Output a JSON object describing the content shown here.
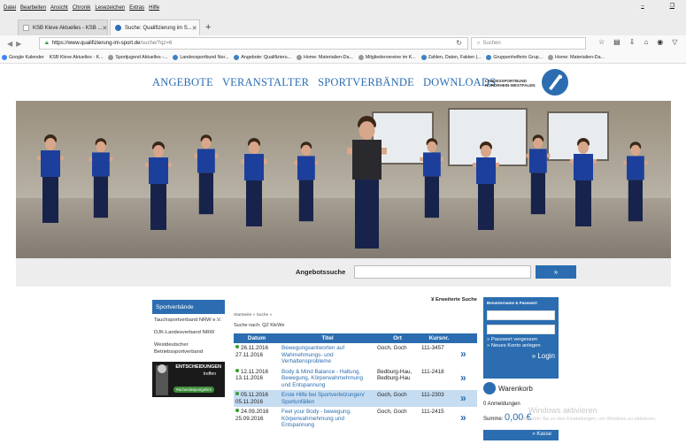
{
  "browser": {
    "menu": [
      "Datei",
      "Bearbeiten",
      "Ansicht",
      "Chronik",
      "Lesezeichen",
      "Extras",
      "Hilfe"
    ],
    "tabs": [
      {
        "label": "KSB Kleve Aktuelles - KSB ..."
      },
      {
        "label": "Suche: Qualifizierung im S..."
      }
    ],
    "url_host": "https://www.qualifizierung-im-sport.de",
    "url_path": "/suche/?qz=6",
    "search_placeholder": "Suchen",
    "bookmarks": [
      "Google Kalender",
      "KSB Kleve Aktuelles - K...",
      "Sportjugend Aktuelles -...",
      "Landessportbund Nor...",
      "Angebote: Qualifizieru...",
      "Home: Materialien-Da...",
      "Mitgliedervereine im K...",
      "Zahlen, Daten, Fakten |...",
      "Gruppenhelferin Grup...",
      "Home: Materialien-Da..."
    ]
  },
  "site": {
    "nav": [
      "ANGEBOTE",
      "VERANSTALTER",
      "SPORTVERBÄNDE",
      "DOWNLOADS"
    ],
    "logo_text": "LANDESSPORTBUND NORDRHEIN-WESTFALEN",
    "search_label": "Angebotssuche",
    "search_button": "»"
  },
  "sidebar": {
    "title": "Sportverbände",
    "items": [
      "Tauchsportverband NRW e.V.",
      "DJK-Landesverband NRW",
      "Westdeutscher Betriebssportverband"
    ],
    "banner_title": "ENTSCHEIDUNGEN",
    "banner_sub": "treffen",
    "banner_pill": "#sicherdiesportgehirn"
  },
  "results": {
    "advanced": "Erweiterte Suche",
    "breadcrumb": "Startseite » Suche »",
    "query": "Suche nach: QZ KleWe",
    "headers": [
      "Datum",
      "Titel",
      "Ort",
      "Kursnr."
    ],
    "rows": [
      {
        "date": "26.11.2016\n27.11.2016",
        "title": "Bewegungsantworten auf Wahrnehmungs- und Verhaltensprobleme",
        "ort": "Goch, Goch",
        "nr": "111-3457"
      },
      {
        "date": "12.11.2016\n13.11.2016",
        "title": "Body & Mind Balance - Haltung, Bewegung, Körperwahrnehmung und Entspannung",
        "ort": "Bedburg-Hau, Bedburg-Hau",
        "nr": "111-2418"
      },
      {
        "date": "05.11.2016\n05.11.2016",
        "title": "Erste Hilfe bei Sportverletzungen/ Sportunfällen",
        "ort": "Goch, Goch",
        "nr": "111-2303"
      },
      {
        "date": "24.09.2016\n25.09.2016",
        "title": "Feel your Body - bewegung, Körperwahrnehmung und Entspannung",
        "ort": "Goch, Goch",
        "nr": "111-2415"
      }
    ],
    "arrow": "»"
  },
  "login": {
    "title": "Benutzername & Passwort",
    "forgot": "» Passwort vergessen",
    "new_account": "» Neues Konto anlegen",
    "login_link": "» Login"
  },
  "cart": {
    "title": "Warenkorb",
    "registrations": "0 Anmeldungen",
    "sum_label": "Summe:",
    "sum_value": "0,00 €",
    "button": "» Kasse"
  },
  "watermark": {
    "line1": "Windows aktivieren",
    "line2": "Wechseln Sie zu den Einstellungen, um Windows zu aktivieren."
  }
}
